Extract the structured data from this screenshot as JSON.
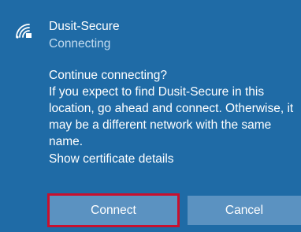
{
  "network": {
    "name": "Dusit-Secure",
    "status": "Connecting",
    "icon": "wifi-secure-icon"
  },
  "message": {
    "title": "Continue connecting?",
    "body_lines": [
      "If you expect to find Dusit-Secure in this",
      "location, go ahead and connect. Otherwise, it",
      "may be a different network with the same",
      "name."
    ],
    "cert_link": "Show certificate details"
  },
  "buttons": {
    "connect": "Connect",
    "cancel": "Cancel"
  },
  "colors": {
    "panel_bg": "#1f6ba6",
    "button_bg": "#5b92c1",
    "highlight": "#c8102e",
    "text": "#ffffff",
    "status_text": "#c3dcf0"
  }
}
